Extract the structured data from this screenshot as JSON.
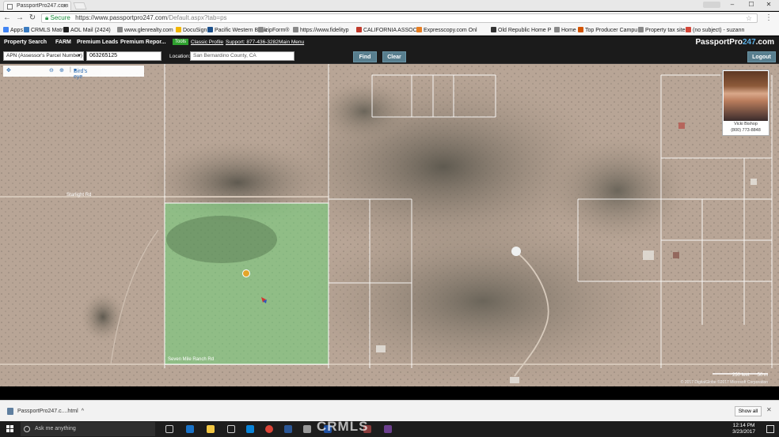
{
  "browser": {
    "tab_title": "PassportPro247.com",
    "secure_label": "Secure",
    "url_host": "https://www.passportpro247.com",
    "url_path": "/Default.aspx?tab=ps",
    "window_user": "——"
  },
  "bookmarks": [
    {
      "label": "Apps",
      "color": "#4285f4"
    },
    {
      "label": "CRMLS Matrix",
      "color": "#3b7bbf"
    },
    {
      "label": "AOL Mail (2424)",
      "color": "#222222"
    },
    {
      "label": "www.glenrealty.com",
      "color": "#888888"
    },
    {
      "label": "DocuSign",
      "color": "#f2b600"
    },
    {
      "label": "Pacific Western Bank",
      "color": "#1b4f8a"
    },
    {
      "label": "zipForm®",
      "color": "#888888"
    },
    {
      "label": "https://www.fidelityp",
      "color": "#888888"
    },
    {
      "label": "CALIFORNIA ASSOCIA",
      "color": "#c0392b"
    },
    {
      "label": "Expresscopy.com Onl",
      "color": "#e67e22"
    },
    {
      "label": "Old Republic Home P",
      "color": "#333333"
    },
    {
      "label": "Home",
      "color": "#888888"
    },
    {
      "label": "Top Producer Campu",
      "color": "#d35400"
    },
    {
      "label": "Property tax site",
      "color": "#888888"
    },
    {
      "label": "(no subject) - suzann",
      "color": "#d44638"
    }
  ],
  "app_header": {
    "property_search": "Property Search",
    "farm": "FARM",
    "premium_leads": "Premium Leads",
    "premium_reports": "Premium Repor...",
    "tools_badge": "Tools",
    "classic_profile": "Classic Profile",
    "support": "Support: 877-436-3282",
    "main_menu": "Main Menu",
    "brand_prefix": "PassportPro",
    "brand_number": "247",
    "brand_suffix": ".com"
  },
  "search": {
    "search_type": "APN (Assessor's Parcel Number)",
    "apn_value": "063265125",
    "location_label": "Location:",
    "location_value": "San Bernardino County, CA",
    "find_label": "Find",
    "clear_label": "Clear",
    "logout_label": "Logout"
  },
  "map": {
    "view_mode": "Bird's eye",
    "road_label": "Starlight Rd",
    "road_label_bottom": "Seven Mile Ranch Rd",
    "scale_label": "250 feet",
    "scale_label_metric": "50 m",
    "copyright": "© 2017 DigitalGlobe ©2017 Microsoft Corporation",
    "colors": {
      "desert": "#b9a595",
      "highlight": "#6fd27a",
      "parcel_line": "#ffffff"
    }
  },
  "agent": {
    "name": "Vicki Bishop",
    "phone": "(800) 773-8848"
  },
  "downloads": {
    "file_name": "PassportPro247.c....html",
    "show_all_label": "Show all"
  },
  "taskbar": {
    "search_placeholder": "Ask me anything",
    "time": "12:14 PM",
    "date": "3/23/2017",
    "watermark": "CRMLS"
  }
}
